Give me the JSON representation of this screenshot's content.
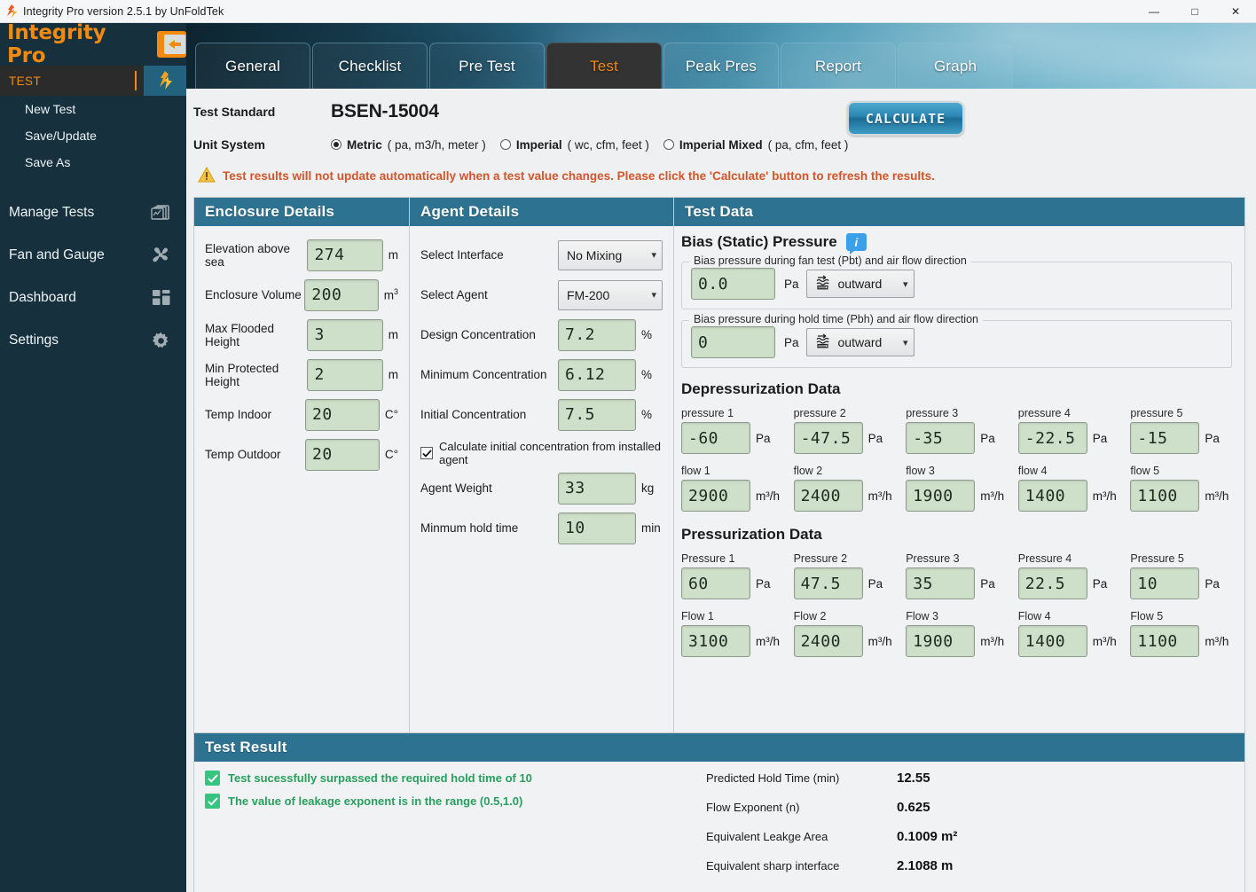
{
  "window": {
    "title": "Integrity Pro version 2.5.1 by UnFoldTek",
    "app_icon": "flame-icon",
    "controls": {
      "minimize": "—",
      "maximize": "□",
      "close": "✕"
    }
  },
  "sidebar": {
    "brand": "Integrity Pro",
    "collapse_icon": "arrow-left-icon",
    "section": {
      "label": "TEST",
      "icon": "flame-icon"
    },
    "sub_items": [
      {
        "label": "New Test"
      },
      {
        "label": "Save/Update"
      },
      {
        "label": "Save As"
      }
    ],
    "items": [
      {
        "label": "Manage Tests",
        "icon": "documents-icon"
      },
      {
        "label": "Fan and Gauge",
        "icon": "fan-icon"
      },
      {
        "label": "Dashboard",
        "icon": "grid-icon"
      },
      {
        "label": "Settings",
        "icon": "gear-icon"
      }
    ]
  },
  "tabs": [
    {
      "label": "General",
      "active": false
    },
    {
      "label": "Checklist",
      "active": false
    },
    {
      "label": "Pre Test",
      "active": false
    },
    {
      "label": "Test",
      "active": true
    },
    {
      "label": "Peak Pres",
      "active": false
    },
    {
      "label": "Report",
      "active": false
    },
    {
      "label": "Graph",
      "active": false
    }
  ],
  "header": {
    "test_standard_label": "Test Standard",
    "test_standard_value": "BSEN-15004",
    "calculate_label": "CALCULATE",
    "unit_system_label": "Unit System",
    "unit_options": [
      {
        "name": "Metric",
        "units": "( pa, m3/h, meter )",
        "selected": true
      },
      {
        "name": "Imperial",
        "units": "( wc, cfm, feet )",
        "selected": false
      },
      {
        "name": "Imperial Mixed",
        "units": "( pa, cfm, feet )",
        "selected": false
      }
    ],
    "warning_icon": "warning-triangle-icon",
    "warning_text": "Test results will not update automatically when a test value changes. Please click the 'Calculate' button to refresh the results."
  },
  "enclosure": {
    "title": "Enclosure Details",
    "fields": [
      {
        "label": "Elevation above sea",
        "value": "274",
        "unit": "m",
        "sup": ""
      },
      {
        "label": "Enclosure Volume",
        "value": "200",
        "unit": "m",
        "sup": "3"
      },
      {
        "label": "Max Flooded Height",
        "value": "3",
        "unit": "m",
        "sup": ""
      },
      {
        "label": "Min Protected Height",
        "value": "2",
        "unit": "m",
        "sup": ""
      },
      {
        "label": "Temp Indoor",
        "value": "20",
        "unit": "C°",
        "sup": ""
      },
      {
        "label": "Temp Outdoor",
        "value": "20",
        "unit": "C°",
        "sup": ""
      }
    ]
  },
  "agent": {
    "title": "Agent Details",
    "interface_label": "Select Interface",
    "interface_value": "No Mixing",
    "agent_label": "Select Agent",
    "agent_value": "FM-200",
    "fields": [
      {
        "label": "Design Concentration",
        "value": "7.2",
        "unit": "%"
      },
      {
        "label": "Minimum Concentration",
        "value": "6.12",
        "unit": "%"
      },
      {
        "label": "Initial Concentration",
        "value": "7.5",
        "unit": "%"
      }
    ],
    "checkbox_label": "Calculate initial concentration from installed agent",
    "checkbox_checked": true,
    "weight_label": "Agent Weight",
    "weight_value": "33",
    "weight_unit": "kg",
    "hold_label": "Minmum hold time",
    "hold_value": "10",
    "hold_unit": "min"
  },
  "testdata": {
    "title": "Test Data",
    "bias_title": "Bias (Static) Pressure",
    "info_icon": "info-bubble-icon",
    "bias_fan": {
      "legend": "Bias pressure during fan test (Pbt) and air flow direction",
      "value": "0.0",
      "unit": "Pa",
      "direction": "outward",
      "direction_icon": "airflow-outward-icon"
    },
    "bias_hold": {
      "legend": "Bias pressure during hold time (Pbh) and air flow direction",
      "value": "0",
      "unit": "Pa",
      "direction": "outward",
      "direction_icon": "airflow-outward-icon"
    },
    "depress": {
      "title": "Depressurization Data",
      "pressure_labels": [
        "pressure 1",
        "pressure 2",
        "pressure 3",
        "pressure 4",
        "pressure 5"
      ],
      "pressure_values": [
        "-60",
        "-47.5",
        "-35",
        "-22.5",
        "-15"
      ],
      "pressure_unit": "Pa",
      "flow_labels": [
        "flow 1",
        "flow 2",
        "flow 3",
        "flow 4",
        "flow 5"
      ],
      "flow_values": [
        "2900",
        "2400",
        "1900",
        "1400",
        "1100"
      ],
      "flow_unit": "m³/h"
    },
    "press": {
      "title": "Pressurization Data",
      "pressure_labels": [
        "Pressure 1",
        "Pressure 2",
        "Pressure 3",
        "Pressure 4",
        "Pressure 5"
      ],
      "pressure_values": [
        "60",
        "47.5",
        "35",
        "22.5",
        "10"
      ],
      "pressure_unit": "Pa",
      "flow_labels": [
        "Flow 1",
        "Flow 2",
        "Flow 3",
        "Flow 4",
        "Flow 5"
      ],
      "flow_values": [
        "3100",
        "2400",
        "1900",
        "1400",
        "1100"
      ],
      "flow_unit": "m³/h"
    }
  },
  "result": {
    "title": "Test Result",
    "messages": [
      "Test sucessfully surpassed the required hold time of 10",
      "The value of leakage exponent is in the range (0.5,1.0)"
    ],
    "metrics": [
      {
        "key": "Predicted Hold Time (min)",
        "value": "12.55"
      },
      {
        "key": "Flow Exponent (n)",
        "value": "0.625"
      },
      {
        "key": "Equivalent Leakge Area",
        "value": "0.1009 m²"
      },
      {
        "key": "Equivalent sharp interface",
        "value": "2.1088 m"
      }
    ]
  },
  "colors": {
    "brand_orange": "#f28a0f",
    "sidebar_bg": "#16303d",
    "panel_header": "#2d7391",
    "lcd_bg": "#cfe0ca",
    "warn_orange": "#d4552a",
    "success_green": "#27a05f"
  }
}
